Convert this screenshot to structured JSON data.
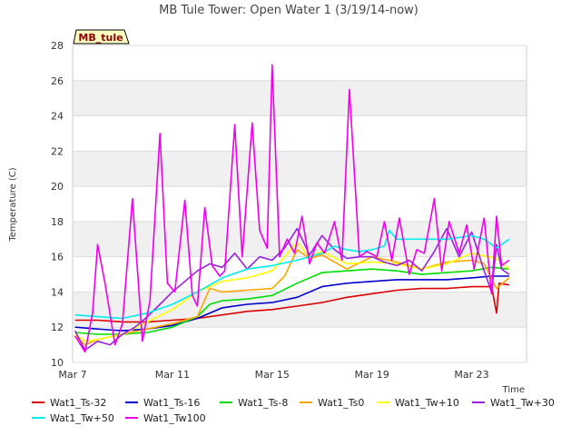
{
  "chart_data": {
    "type": "line",
    "title": "MB Tule Tower: Open Water 1 (3/19/14-now)",
    "xlabel": "Time",
    "ylabel": "Temperature (C)",
    "badge": "MB_tule",
    "x_range": [
      "2014-03-07",
      "2014-03-25"
    ],
    "ylim": [
      10,
      28
    ],
    "yticks": [
      10,
      12,
      14,
      16,
      18,
      20,
      22,
      24,
      26,
      28
    ],
    "xticks": [
      {
        "label": "Mar 7",
        "day": 7
      },
      {
        "label": "Mar 11",
        "day": 11
      },
      {
        "label": "Mar 15",
        "day": 15
      },
      {
        "label": "Mar 19",
        "day": 19
      },
      {
        "label": "Mar 23",
        "day": 23
      }
    ],
    "grid": true,
    "legend_position": "bottom",
    "series": [
      {
        "name": "Wat1_Ts-32",
        "color": "#dd0000",
        "x": [
          7.1,
          8.0,
          9.0,
          10.0,
          11.0,
          12.0,
          13.0,
          14.0,
          15.0,
          16.0,
          17.0,
          18.0,
          19.0,
          20.0,
          21.0,
          22.0,
          23.0,
          23.8,
          24.0,
          24.1,
          24.5
        ],
        "y": [
          12.4,
          12.4,
          12.3,
          12.3,
          12.4,
          12.5,
          12.7,
          12.9,
          13.0,
          13.2,
          13.4,
          13.7,
          13.9,
          14.1,
          14.2,
          14.2,
          14.3,
          14.3,
          12.8,
          14.5,
          14.4
        ]
      },
      {
        "name": "Wat1_Ts-16",
        "color": "#0000cc",
        "x": [
          7.1,
          8.0,
          9.0,
          10.0,
          11.0,
          12.0,
          13.0,
          14.0,
          15.0,
          16.0,
          17.0,
          18.0,
          19.0,
          20.0,
          21.0,
          22.0,
          23.0,
          23.8,
          24.5
        ],
        "y": [
          12.0,
          11.9,
          11.8,
          11.9,
          12.1,
          12.5,
          13.1,
          13.3,
          13.4,
          13.7,
          14.3,
          14.5,
          14.6,
          14.7,
          14.7,
          14.7,
          14.8,
          14.9,
          14.9
        ]
      },
      {
        "name": "Wat1_Ts-8",
        "color": "#00dd00",
        "x": [
          7.1,
          8.0,
          9.0,
          10.0,
          11.0,
          12.0,
          12.5,
          13.0,
          14.0,
          15.0,
          16.0,
          17.0,
          18.0,
          19.0,
          20.0,
          21.0,
          22.0,
          23.0,
          23.8,
          24.5
        ],
        "y": [
          11.7,
          11.6,
          11.6,
          11.7,
          12.0,
          12.6,
          13.3,
          13.5,
          13.6,
          13.8,
          14.5,
          15.1,
          15.2,
          15.3,
          15.2,
          15.0,
          15.1,
          15.2,
          15.4,
          15.3
        ]
      },
      {
        "name": "Wat1_Ts0",
        "color": "#ffa500",
        "x": [
          7.1,
          7.5,
          8.0,
          9.0,
          10.0,
          11.0,
          12.0,
          12.5,
          13.0,
          14.0,
          15.0,
          15.5,
          16.0,
          16.5,
          17.0,
          18.0,
          19.0,
          20.0,
          21.0,
          22.0,
          23.0,
          23.5,
          24.0,
          24.5
        ],
        "y": [
          11.5,
          11.0,
          11.3,
          11.6,
          11.9,
          12.2,
          12.6,
          14.2,
          14.0,
          14.1,
          14.2,
          14.9,
          16.4,
          15.9,
          16.1,
          15.3,
          16.0,
          15.7,
          15.3,
          15.7,
          15.8,
          15.6,
          14.2,
          14.8
        ]
      },
      {
        "name": "Wat1_Tw+10",
        "color": "#ffff00",
        "x": [
          7.1,
          7.5,
          8.0,
          9.0,
          10.0,
          11.0,
          12.0,
          13.0,
          14.0,
          15.0,
          16.0,
          16.5,
          17.0,
          18.0,
          19.0,
          20.0,
          21.0,
          22.0,
          23.0,
          24.0,
          24.5
        ],
        "y": [
          11.6,
          11.2,
          11.3,
          11.6,
          12.3,
          13.0,
          14.0,
          14.6,
          14.8,
          15.2,
          16.8,
          16.0,
          16.3,
          15.6,
          15.7,
          15.6,
          15.3,
          15.6,
          16.2,
          15.9,
          15.3
        ]
      },
      {
        "name": "Wat1_Tw+30",
        "color": "#9922dd",
        "x": [
          7.1,
          7.5,
          8.0,
          8.5,
          9.0,
          9.5,
          10.0,
          10.5,
          11.0,
          11.5,
          12.0,
          12.5,
          13.0,
          13.5,
          14.0,
          14.5,
          15.0,
          15.5,
          16.0,
          16.5,
          17.0,
          17.5,
          18.0,
          18.5,
          19.0,
          19.5,
          20.0,
          20.5,
          21.0,
          21.5,
          22.0,
          22.5,
          23.0,
          23.5,
          23.8,
          24.0,
          24.2,
          24.5
        ],
        "y": [
          11.8,
          10.7,
          11.2,
          11.0,
          11.6,
          12.0,
          12.6,
          13.3,
          14.0,
          14.6,
          15.2,
          15.6,
          15.4,
          16.2,
          15.3,
          16.0,
          15.8,
          16.5,
          17.6,
          16.1,
          17.2,
          16.4,
          15.9,
          16.0,
          16.0,
          15.7,
          15.5,
          15.8,
          15.2,
          16.3,
          17.6,
          16.0,
          17.4,
          15.2,
          14.0,
          16.7,
          15.3,
          15.0
        ]
      },
      {
        "name": "Wat1_Tw+50",
        "color": "#00eeee",
        "x": [
          7.1,
          8.0,
          9.0,
          10.0,
          11.0,
          12.0,
          13.0,
          14.0,
          15.0,
          16.0,
          17.0,
          17.5,
          18.0,
          18.5,
          19.0,
          19.5,
          19.7,
          20.0,
          21.0,
          22.0,
          23.0,
          23.5,
          24.0,
          24.5
        ],
        "y": [
          12.7,
          12.6,
          12.5,
          12.8,
          13.3,
          14.0,
          14.8,
          15.3,
          15.5,
          15.8,
          16.2,
          16.6,
          16.4,
          16.3,
          16.4,
          16.6,
          17.5,
          17.0,
          17.0,
          17.0,
          17.2,
          17.0,
          16.5,
          17.0
        ]
      },
      {
        "name": "Wat1_Tw100",
        "color": "#ee00ee",
        "x": [
          7.1,
          7.5,
          7.8,
          8.0,
          8.3,
          8.7,
          9.0,
          9.4,
          9.8,
          10.1,
          10.5,
          10.8,
          11.1,
          11.5,
          11.8,
          12.0,
          12.3,
          12.6,
          12.9,
          13.1,
          13.5,
          13.8,
          14.2,
          14.5,
          14.8,
          15.0,
          15.3,
          15.6,
          15.9,
          16.2,
          16.5,
          16.8,
          17.1,
          17.5,
          17.8,
          18.1,
          18.5,
          18.8,
          19.2,
          19.5,
          19.8,
          20.1,
          20.5,
          20.8,
          21.1,
          21.5,
          21.8,
          22.1,
          22.5,
          22.8,
          23.1,
          23.5,
          23.8,
          24.0,
          24.2,
          24.5
        ],
        "y": [
          11.5,
          10.6,
          12.8,
          16.7,
          14.5,
          11.0,
          12.2,
          19.3,
          11.2,
          13.5,
          23.0,
          14.5,
          14.0,
          19.2,
          13.8,
          13.2,
          18.8,
          15.5,
          14.9,
          15.2,
          23.5,
          16.0,
          23.6,
          17.5,
          16.5,
          26.9,
          16.0,
          17.0,
          16.2,
          18.3,
          15.6,
          16.8,
          16.2,
          18.0,
          15.8,
          25.5,
          16.0,
          16.3,
          16.0,
          18.0,
          15.8,
          18.2,
          15.0,
          16.4,
          16.2,
          19.3,
          15.2,
          18.0,
          16.2,
          17.8,
          15.3,
          18.2,
          13.9,
          18.3,
          15.5,
          15.8
        ]
      }
    ]
  }
}
